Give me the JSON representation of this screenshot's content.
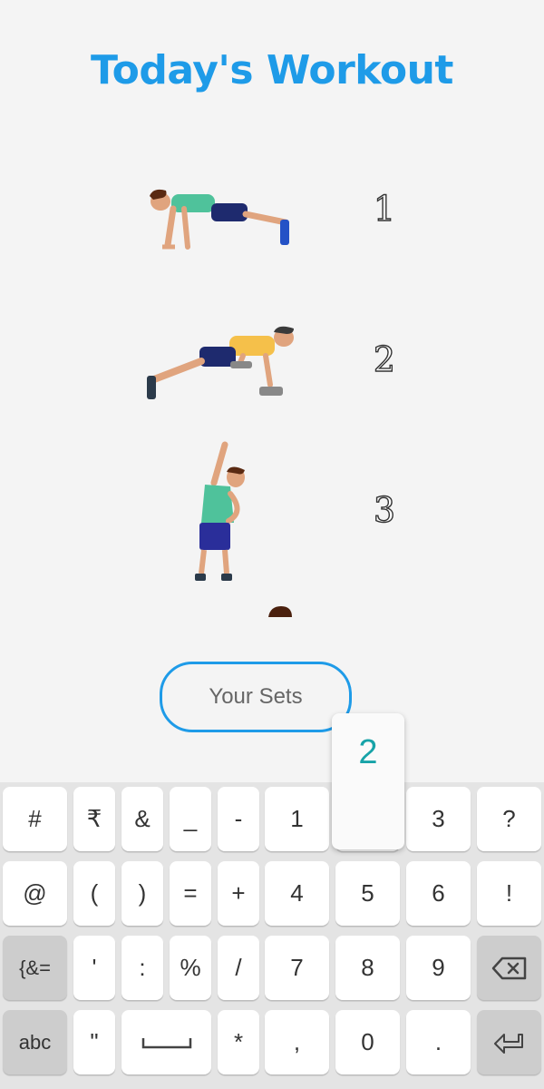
{
  "title": "Today's Workout",
  "exercises": [
    {
      "number": "1",
      "name": "push-up"
    },
    {
      "number": "2",
      "name": "dumbbell-plank-row"
    },
    {
      "number": "3",
      "name": "side-stretch"
    }
  ],
  "sets_button": {
    "label": "Your Sets"
  },
  "key_preview": "2",
  "keyboard": {
    "row1": [
      "#",
      "₹",
      "&",
      "_",
      "-",
      "1",
      "2",
      "3",
      "?"
    ],
    "row2": [
      "@",
      "(",
      ")",
      "=",
      "+",
      "4",
      "5",
      "6",
      "!"
    ],
    "row3": [
      "{&=",
      "'",
      ":",
      "%",
      "/",
      "7",
      "8",
      "9"
    ],
    "row4": [
      "abc",
      "\"",
      "*",
      ",",
      "0",
      "."
    ]
  },
  "colors": {
    "accent": "#1e9be8",
    "preview": "#17a3a8"
  }
}
